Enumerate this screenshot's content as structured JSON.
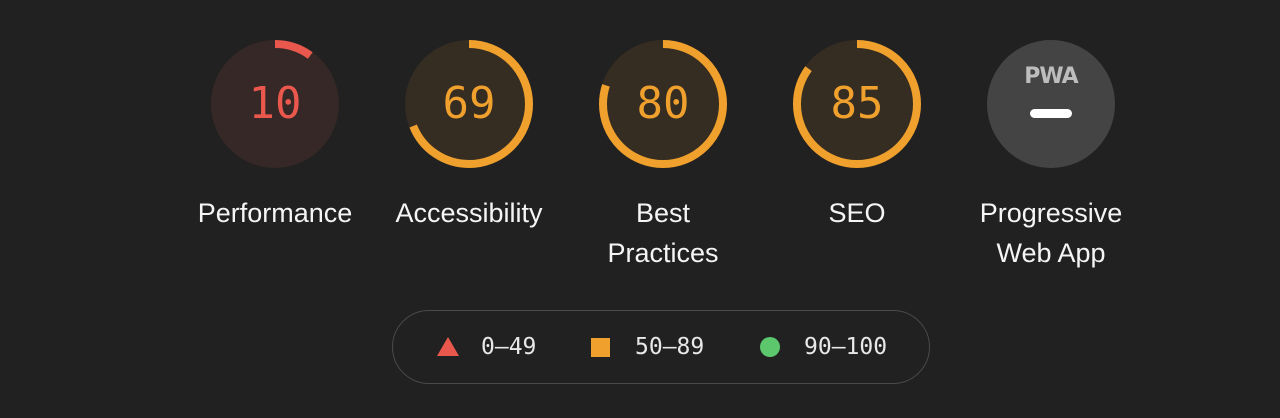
{
  "gauges": [
    {
      "id": "performance",
      "score": "10",
      "score_value": 10,
      "label": "Performance",
      "color": "#ea584d",
      "bg": "#352826"
    },
    {
      "id": "accessibility",
      "score": "69",
      "score_value": 69,
      "label": "Accessibility",
      "color": "#f0a02d",
      "bg": "#352d22"
    },
    {
      "id": "best-practices",
      "score": "80",
      "score_value": 80,
      "label_line1": "Best",
      "label_line2": "Practices",
      "color": "#f0a02d",
      "bg": "#352d22"
    },
    {
      "id": "seo",
      "score": "85",
      "score_value": 85,
      "label": "SEO",
      "color": "#f0a02d",
      "bg": "#352d22"
    }
  ],
  "pwa": {
    "logo_text": "PWA",
    "label_line1": "Progressive",
    "label_line2": "Web App",
    "bg": "#444444"
  },
  "legend": {
    "items": [
      {
        "range": "0–49",
        "shape": "triangle-icon",
        "color": "#ea584d"
      },
      {
        "range": "50–89",
        "shape": "square-icon",
        "color": "#f0a02d"
      },
      {
        "range": "90–100",
        "shape": "circle-icon",
        "color": "#5cc76c"
      }
    ]
  }
}
